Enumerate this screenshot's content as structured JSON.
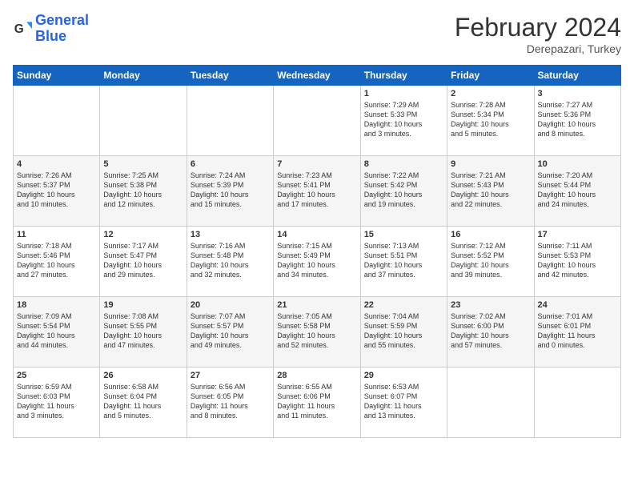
{
  "header": {
    "logo_line1": "General",
    "logo_line2": "Blue",
    "month_year": "February 2024",
    "location": "Derepazari, Turkey"
  },
  "days_of_week": [
    "Sunday",
    "Monday",
    "Tuesday",
    "Wednesday",
    "Thursday",
    "Friday",
    "Saturday"
  ],
  "weeks": [
    [
      {
        "day": "",
        "content": ""
      },
      {
        "day": "",
        "content": ""
      },
      {
        "day": "",
        "content": ""
      },
      {
        "day": "",
        "content": ""
      },
      {
        "day": "1",
        "content": "Sunrise: 7:29 AM\nSunset: 5:33 PM\nDaylight: 10 hours\nand 3 minutes."
      },
      {
        "day": "2",
        "content": "Sunrise: 7:28 AM\nSunset: 5:34 PM\nDaylight: 10 hours\nand 5 minutes."
      },
      {
        "day": "3",
        "content": "Sunrise: 7:27 AM\nSunset: 5:36 PM\nDaylight: 10 hours\nand 8 minutes."
      }
    ],
    [
      {
        "day": "4",
        "content": "Sunrise: 7:26 AM\nSunset: 5:37 PM\nDaylight: 10 hours\nand 10 minutes."
      },
      {
        "day": "5",
        "content": "Sunrise: 7:25 AM\nSunset: 5:38 PM\nDaylight: 10 hours\nand 12 minutes."
      },
      {
        "day": "6",
        "content": "Sunrise: 7:24 AM\nSunset: 5:39 PM\nDaylight: 10 hours\nand 15 minutes."
      },
      {
        "day": "7",
        "content": "Sunrise: 7:23 AM\nSunset: 5:41 PM\nDaylight: 10 hours\nand 17 minutes."
      },
      {
        "day": "8",
        "content": "Sunrise: 7:22 AM\nSunset: 5:42 PM\nDaylight: 10 hours\nand 19 minutes."
      },
      {
        "day": "9",
        "content": "Sunrise: 7:21 AM\nSunset: 5:43 PM\nDaylight: 10 hours\nand 22 minutes."
      },
      {
        "day": "10",
        "content": "Sunrise: 7:20 AM\nSunset: 5:44 PM\nDaylight: 10 hours\nand 24 minutes."
      }
    ],
    [
      {
        "day": "11",
        "content": "Sunrise: 7:18 AM\nSunset: 5:46 PM\nDaylight: 10 hours\nand 27 minutes."
      },
      {
        "day": "12",
        "content": "Sunrise: 7:17 AM\nSunset: 5:47 PM\nDaylight: 10 hours\nand 29 minutes."
      },
      {
        "day": "13",
        "content": "Sunrise: 7:16 AM\nSunset: 5:48 PM\nDaylight: 10 hours\nand 32 minutes."
      },
      {
        "day": "14",
        "content": "Sunrise: 7:15 AM\nSunset: 5:49 PM\nDaylight: 10 hours\nand 34 minutes."
      },
      {
        "day": "15",
        "content": "Sunrise: 7:13 AM\nSunset: 5:51 PM\nDaylight: 10 hours\nand 37 minutes."
      },
      {
        "day": "16",
        "content": "Sunrise: 7:12 AM\nSunset: 5:52 PM\nDaylight: 10 hours\nand 39 minutes."
      },
      {
        "day": "17",
        "content": "Sunrise: 7:11 AM\nSunset: 5:53 PM\nDaylight: 10 hours\nand 42 minutes."
      }
    ],
    [
      {
        "day": "18",
        "content": "Sunrise: 7:09 AM\nSunset: 5:54 PM\nDaylight: 10 hours\nand 44 minutes."
      },
      {
        "day": "19",
        "content": "Sunrise: 7:08 AM\nSunset: 5:55 PM\nDaylight: 10 hours\nand 47 minutes."
      },
      {
        "day": "20",
        "content": "Sunrise: 7:07 AM\nSunset: 5:57 PM\nDaylight: 10 hours\nand 49 minutes."
      },
      {
        "day": "21",
        "content": "Sunrise: 7:05 AM\nSunset: 5:58 PM\nDaylight: 10 hours\nand 52 minutes."
      },
      {
        "day": "22",
        "content": "Sunrise: 7:04 AM\nSunset: 5:59 PM\nDaylight: 10 hours\nand 55 minutes."
      },
      {
        "day": "23",
        "content": "Sunrise: 7:02 AM\nSunset: 6:00 PM\nDaylight: 10 hours\nand 57 minutes."
      },
      {
        "day": "24",
        "content": "Sunrise: 7:01 AM\nSunset: 6:01 PM\nDaylight: 11 hours\nand 0 minutes."
      }
    ],
    [
      {
        "day": "25",
        "content": "Sunrise: 6:59 AM\nSunset: 6:03 PM\nDaylight: 11 hours\nand 3 minutes."
      },
      {
        "day": "26",
        "content": "Sunrise: 6:58 AM\nSunset: 6:04 PM\nDaylight: 11 hours\nand 5 minutes."
      },
      {
        "day": "27",
        "content": "Sunrise: 6:56 AM\nSunset: 6:05 PM\nDaylight: 11 hours\nand 8 minutes."
      },
      {
        "day": "28",
        "content": "Sunrise: 6:55 AM\nSunset: 6:06 PM\nDaylight: 11 hours\nand 11 minutes."
      },
      {
        "day": "29",
        "content": "Sunrise: 6:53 AM\nSunset: 6:07 PM\nDaylight: 11 hours\nand 13 minutes."
      },
      {
        "day": "",
        "content": ""
      },
      {
        "day": "",
        "content": ""
      }
    ]
  ]
}
